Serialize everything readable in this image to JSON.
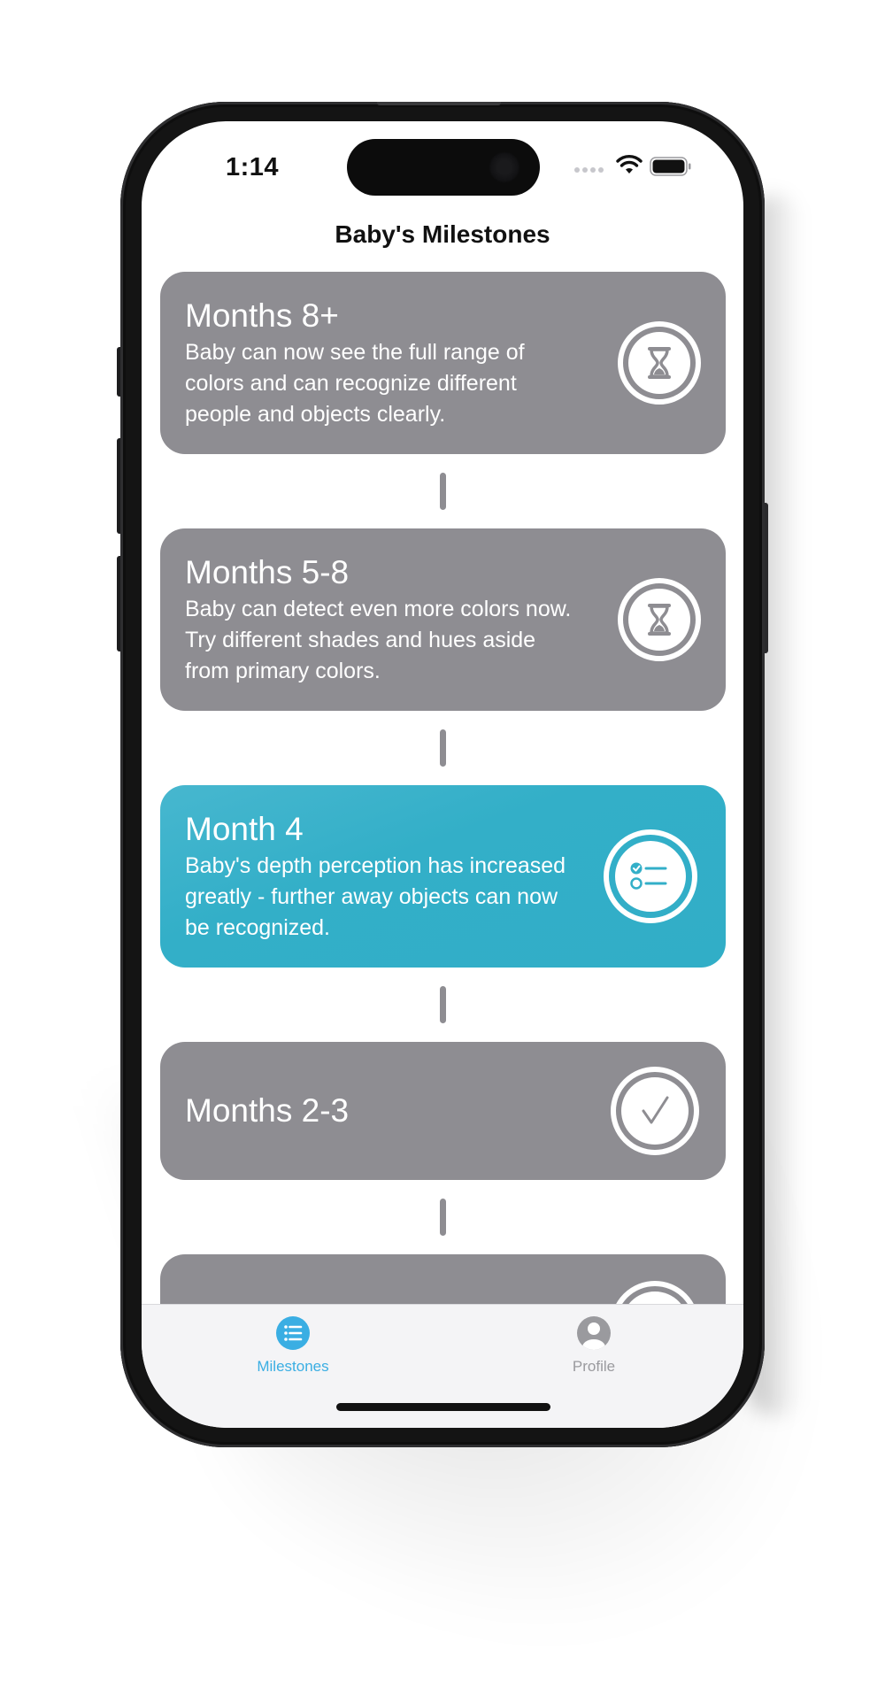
{
  "status_bar": {
    "time": "1:14",
    "icons": [
      "signal-dots-icon",
      "wifi-icon",
      "battery-icon"
    ]
  },
  "nav": {
    "title": "Baby's Milestones"
  },
  "milestones": [
    {
      "title": "Months 8+",
      "description": "Baby can now see the full range of colors and can recognize different people and objects clearly.",
      "status": "upcoming",
      "icon": "hourglass-icon"
    },
    {
      "title": "Months 5-8",
      "description": "Baby can detect even more colors now. Try different shades and hues aside from primary colors.",
      "status": "upcoming",
      "icon": "hourglass-icon"
    },
    {
      "title": "Month 4",
      "description": "Baby's depth perception has increased greatly - further away objects can now be recognized.",
      "status": "current",
      "icon": "checklist-icon"
    },
    {
      "title": "Months 2-3",
      "description": "",
      "status": "completed",
      "icon": "checkmark-icon"
    },
    {
      "title": "",
      "description": "",
      "status": "completed",
      "icon": "checkmark-icon"
    }
  ],
  "tabbar": {
    "tabs": [
      {
        "label": "Milestones",
        "icon": "list-bullet-icon",
        "selected": true
      },
      {
        "label": "Profile",
        "icon": "person-circle-icon",
        "selected": false
      }
    ]
  },
  "colors": {
    "accent": "#3aaee3",
    "active_card": "#33afc8",
    "inactive_card": "#8e8d92",
    "tab_inactive": "#9a9a9e"
  }
}
